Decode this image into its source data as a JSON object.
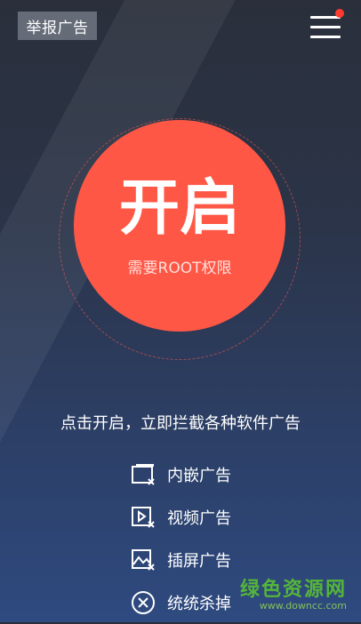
{
  "header": {
    "report_label": "举报广告",
    "menu_icon": "menu-icon"
  },
  "main_button": {
    "label": "开启",
    "subtitle": "需要ROOT权限",
    "color": "#ff5745"
  },
  "headline": "点击开启，立即拦截各种软件广告",
  "features": [
    {
      "icon": "embedded-ad-icon",
      "label": "内嵌广告"
    },
    {
      "icon": "video-ad-icon",
      "label": "视频广告"
    },
    {
      "icon": "interstitial-ad-icon",
      "label": "插屏广告"
    },
    {
      "icon": "close-circle-icon",
      "label": "统统杀掉"
    }
  ],
  "watermark": {
    "title": "绿色资源网",
    "url": "www.downcc.com"
  }
}
